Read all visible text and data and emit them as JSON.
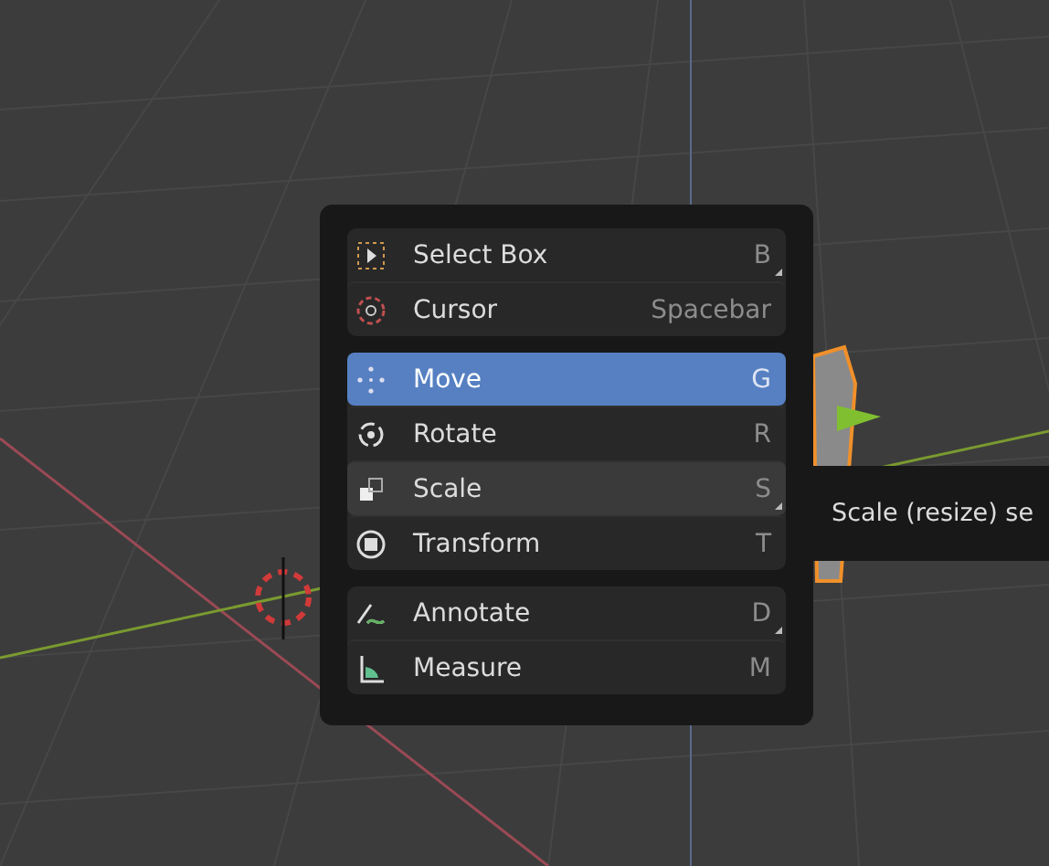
{
  "menu": {
    "groups": [
      {
        "items": [
          {
            "kind": "select-box",
            "label": "Select Box",
            "shortcut": "B",
            "selected": false,
            "hovered": false,
            "variants": true
          },
          {
            "kind": "cursor",
            "label": "Cursor",
            "shortcut": "Spacebar",
            "selected": false,
            "hovered": false,
            "variants": false
          }
        ]
      },
      {
        "items": [
          {
            "kind": "move",
            "label": "Move",
            "shortcut": "G",
            "selected": true,
            "hovered": false,
            "variants": false
          },
          {
            "kind": "rotate",
            "label": "Rotate",
            "shortcut": "R",
            "selected": false,
            "hovered": false,
            "variants": false
          },
          {
            "kind": "scale",
            "label": "Scale",
            "shortcut": "S",
            "selected": false,
            "hovered": true,
            "variants": true
          },
          {
            "kind": "transform",
            "label": "Transform",
            "shortcut": "T",
            "selected": false,
            "hovered": false,
            "variants": false
          }
        ]
      },
      {
        "items": [
          {
            "kind": "annotate",
            "label": "Annotate",
            "shortcut": "D",
            "selected": false,
            "hovered": false,
            "variants": true
          },
          {
            "kind": "measure",
            "label": "Measure",
            "shortcut": "M",
            "selected": false,
            "hovered": false,
            "variants": false
          }
        ]
      }
    ]
  },
  "tooltip": {
    "text": "Scale (resize) se"
  }
}
